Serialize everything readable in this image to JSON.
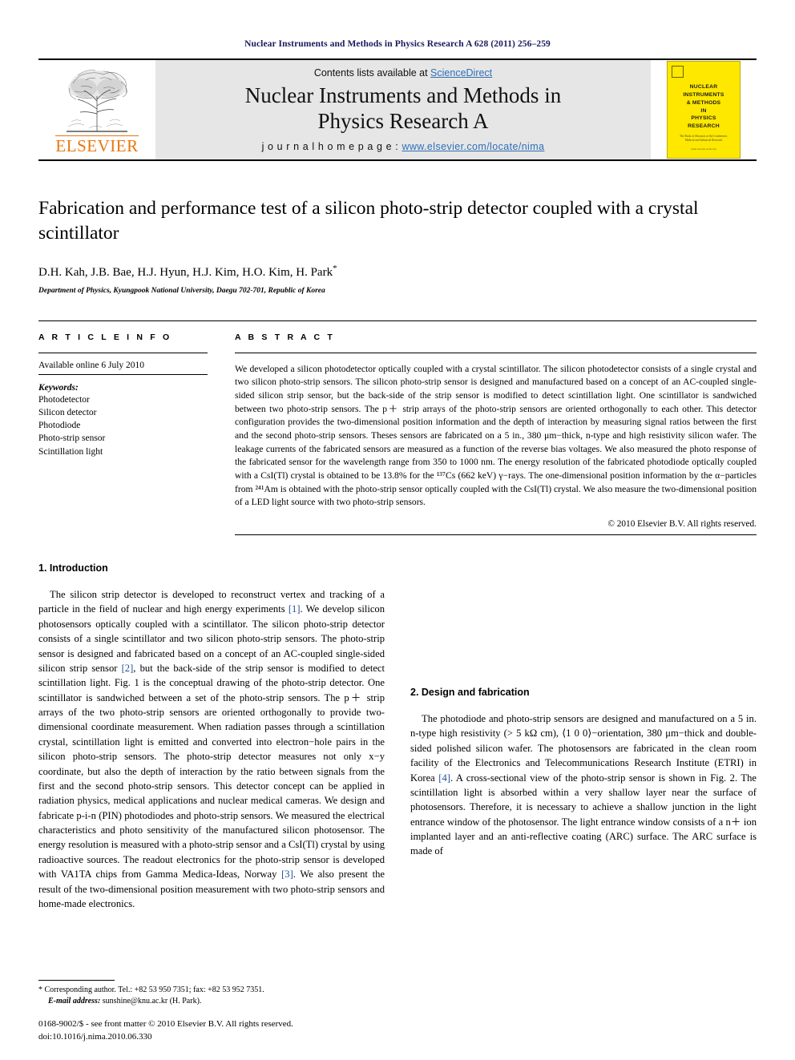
{
  "running_head": "Nuclear Instruments and Methods in Physics Research A 628 (2011) 256–259",
  "masthead": {
    "contents_prefix": "Contents lists available at ",
    "sciencedirect": "ScienceDirect",
    "journal_title_line1": "Nuclear Instruments and Methods in",
    "journal_title_line2": "Physics Research A",
    "homepage_label": "j o u r n a l   h o m e p a g e :  ",
    "homepage_url": "www.elsevier.com/locate/nima",
    "publisher": "ELSEVIER",
    "cover": {
      "title_lines": [
        "NUCLEAR",
        "INSTRUMENTS",
        "& METHODS",
        "IN",
        "PHYSICS",
        "RESEARCH"
      ],
      "subtitle": "The Book of Abstracts of the Conference, Medical and Industrial Research",
      "footer": "Some text line at the foot"
    }
  },
  "article": {
    "title": "Fabrication and performance test of a silicon photo-strip detector coupled with a crystal scintillator",
    "authors": "D.H. Kah, J.B. Bae, H.J. Hyun, H.J. Kim, H.O. Kim, H. Park",
    "author_marker": "*",
    "affiliation": "Department of Physics, Kyungpook National University, Daegu 702-701, Republic of Korea"
  },
  "article_info": {
    "heading": "A R T I C L E   I N F O",
    "available_online": "Available online 6 July 2010",
    "keywords_label": "Keywords:",
    "keywords": [
      "Photodetector",
      "Silicon detector",
      "Photodiode",
      "Photo-strip sensor",
      "Scintillation light"
    ]
  },
  "abstract": {
    "heading": "A B S T R A C T",
    "text": "We developed a silicon photodetector optically coupled with a crystal scintillator. The silicon photodetector consists of a single crystal and two silicon photo-strip sensors. The silicon photo-strip sensor is designed and manufactured based on a concept of an AC-coupled single-sided silicon strip sensor, but the back-side of the strip sensor is modified to detect scintillation light. One scintillator is sandwiched between two photo-strip sensors. The p＋ strip arrays of the photo-strip sensors are oriented orthogonally to each other. This detector configuration provides the two-dimensional position information and the depth of interaction by measuring signal ratios between the first and the second photo-strip sensors. Theses sensors are fabricated on a 5 in., 380 μm−thick, n-type and high resistivity silicon wafer. The leakage currents of the fabricated sensors are measured as a function of the reverse bias voltages. We also measured the photo response of the fabricated sensor for the wavelength range from 350 to 1000 nm. The energy resolution of the fabricated photodiode optically coupled with a CsI(Tl) crystal is obtained to be 13.8% for the ¹³⁷Cs (662 keV) γ−rays. The one-dimensional position information by the α−particles from ²⁴¹Am is obtained with the photo-strip sensor optically coupled with the CsI(Tl) crystal. We also measure the two-dimensional position of a LED light source with two photo-strip sensors.",
    "copyright": "© 2010 Elsevier B.V. All rights reserved."
  },
  "sections": {
    "intro_heading": "1.  Introduction",
    "intro_para": "The silicon strip detector is developed to reconstruct vertex and tracking of a particle in the field of nuclear and high energy experiments [1]. We develop silicon photosensors optically coupled with a scintillator. The silicon photo-strip detector consists of a single scintillator and two silicon photo-strip sensors. The photo-strip sensor is designed and fabricated based on a concept of an AC-coupled single-sided silicon strip sensor [2], but the back-side of the strip sensor is modified to detect scintillation light. Fig. 1 is the conceptual drawing of the photo-strip detector. One scintillator is sandwiched between a set of the photo-strip sensors. The p＋ strip arrays of the two photo-strip sensors are oriented orthogonally to provide two-dimensional coordinate measurement. When radiation passes through a scintillation crystal, scintillation light is emitted and converted into electron−hole pairs in the silicon photo-strip sensors. The photo-strip detector measures not only x−y coordinate, but also the depth of interaction by the ratio between signals from the first and the second photo-strip sensors. This detector concept can be applied in radiation physics, medical applications and nuclear medical cameras. We design and fabricate p-i-n (PIN) photodiodes and photo-strip sensors. We measured the electrical characteristics and photo sensitivity of the manufactured silicon photosensor. The energy resolution is measured with a photo-strip sensor and a CsI(Tl) crystal by using radioactive sources. The readout electronics for the photo-strip sensor is developed with VA1TA chips from Gamma Medica-Ideas, Norway [3]. We also present the result of the two-dimensional position measurement with two photo-strip sensors and home-made electronics.",
    "design_heading": "2.  Design and fabrication",
    "design_para": "The photodiode and photo-strip sensors are designed and manufactured on a 5 in. n-type high resistivity (> 5 kΩ cm), ⟨1 0 0⟩−orientation, 380 μm−thick and double-sided polished silicon wafer. The photosensors are fabricated in the clean room facility of the Electronics and Telecommunications Research Institute (ETRI) in Korea [4]. A cross-sectional view of the photo-strip sensor is shown in Fig. 2. The scintillation light is absorbed within a very shallow layer near the surface of photosensors. Therefore, it is necessary to achieve a shallow junction in the light entrance window of the photosensor. The light entrance window consists of a n＋ ion implanted layer and an anti-reflective coating (ARC) surface. The ARC surface is made of"
  },
  "footnotes": {
    "corresponding": "* Corresponding author. Tel.: +82 53 950 7351; fax: +82 53 952 7351.",
    "email_label": "E-mail address:",
    "email_value": " sunshine@knu.ac.kr (H. Park).",
    "front_matter": "0168-9002/$ - see front matter © 2010 Elsevier B.V. All rights reserved.",
    "doi": "doi:10.1016/j.nima.2010.06.330"
  }
}
